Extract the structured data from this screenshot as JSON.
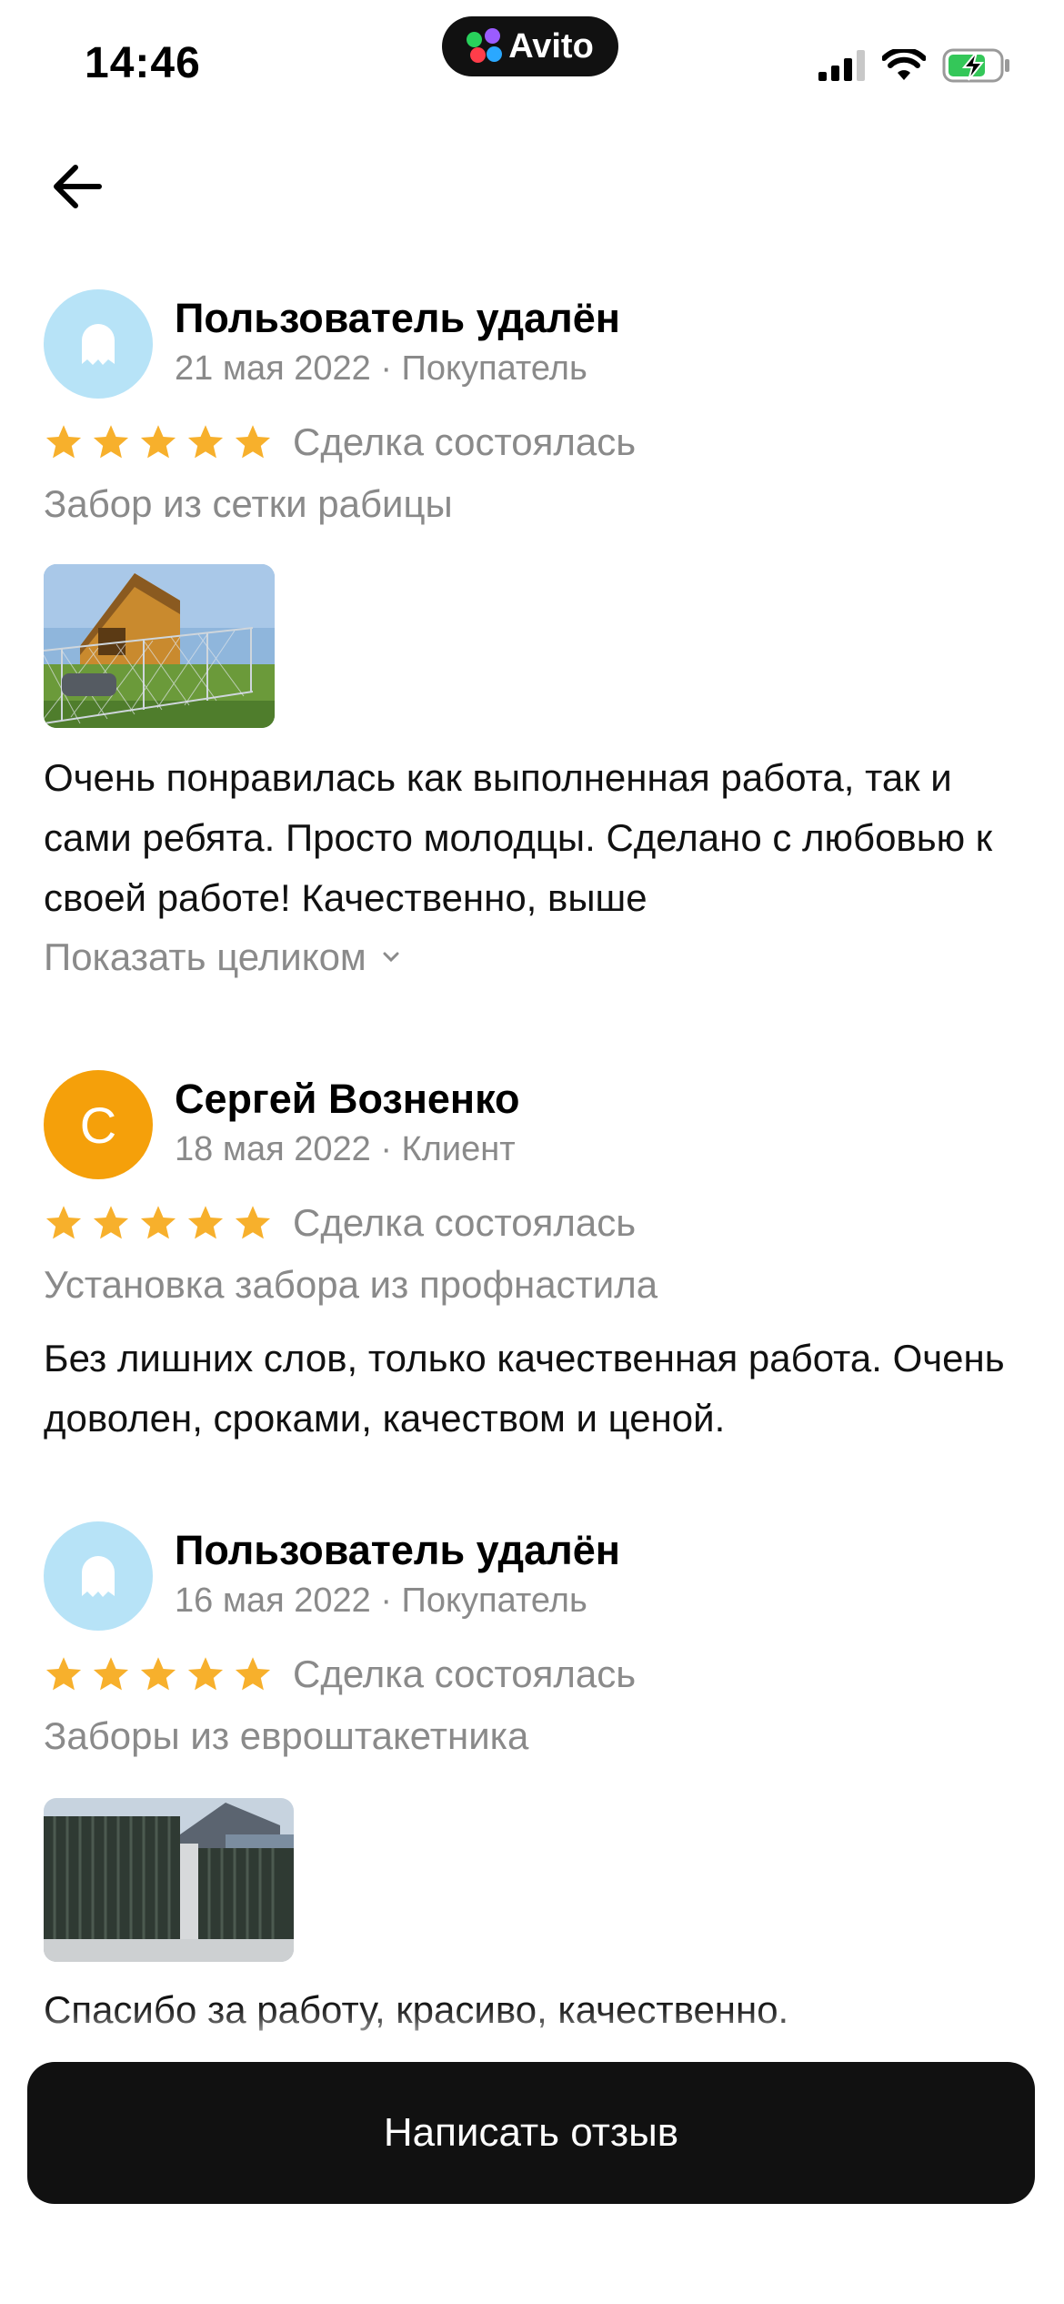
{
  "status_bar": {
    "time": "14:46",
    "app_badge": "Avito"
  },
  "reviews": [
    {
      "author": "Пользователь удалён",
      "date": "21 мая 2022",
      "role": "Покупатель",
      "avatar": "ghost-icon",
      "rating": 5,
      "deal_status": "Сделка состоялась",
      "service": "Забор из сетки рабицы",
      "text": "Очень понравилась как выполненная работа, так и сами ребята. Просто молодцы. Сделано с любовью к своей работе! Качественно, выше",
      "show_more": "Показать целиком"
    },
    {
      "author": "Сергей Возненко",
      "date": "18 мая 2022",
      "role": "Клиент",
      "avatar_letter": "С",
      "rating": 5,
      "deal_status": "Сделка состоялась",
      "service": "Установка забора из профнастила",
      "text": "Без лишних слов, только качественная работа. Очень доволен, сроками, качеством и ценой."
    },
    {
      "author": "Пользователь удалён",
      "date": "16 мая 2022",
      "role": "Покупатель",
      "avatar": "ghost-icon",
      "rating": 5,
      "deal_status": "Сделка состоялась",
      "service": "Заборы из евроштакетника",
      "text": "Спасибо за работу, красиво, качественно."
    }
  ],
  "meta_separator": " · ",
  "write_review_label": "Написать отзыв",
  "colors": {
    "star": "#f7b02c",
    "accent_orange": "#f5a00a",
    "ghost_bg": "#b7e3f7",
    "button": "#111111"
  }
}
